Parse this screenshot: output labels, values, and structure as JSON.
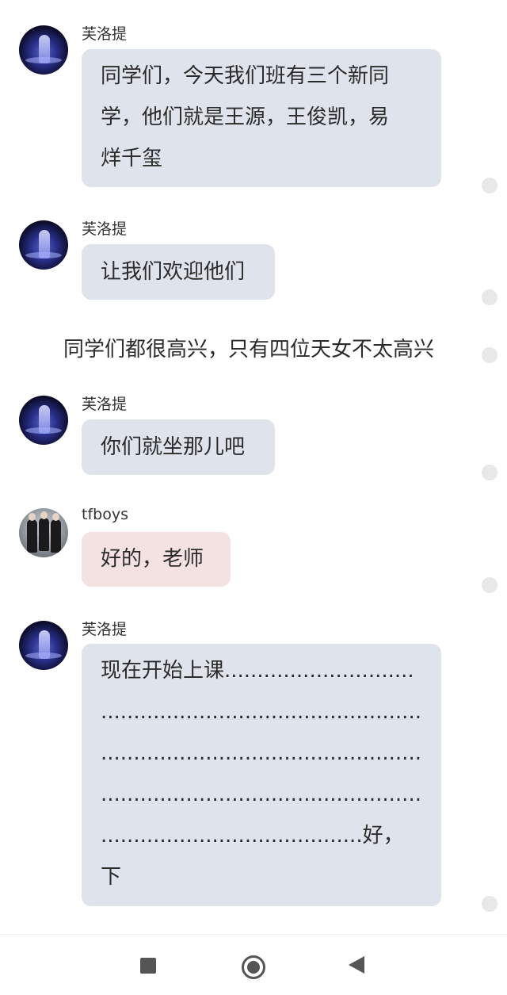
{
  "messages": [
    {
      "sender": "芙洛提",
      "text": "同学们，今天我们班有三个新同\n学，他们就是王源，王俊凯，易\n烊千玺"
    },
    {
      "sender": "芙洛提",
      "text": "让我们欢迎他们"
    },
    {
      "sender": "芙洛提",
      "text": "你们就坐那儿吧"
    },
    {
      "sender": "tfboys",
      "text": "好的，老师"
    },
    {
      "sender": "芙洛提",
      "text": "现在开始上课.............................\n.................................................\n.................................................\n.................................................\n........................................好，下\n课"
    }
  ],
  "narration": "同学们都很高兴，只有四位天女不太高兴",
  "icons": {
    "teacher_avatar": "avatar-icon",
    "tfboys_avatar": "avatar-icon",
    "recent_apps": "square-icon",
    "home": "circle-icon",
    "back": "triangle-icon"
  },
  "colors": {
    "bubble_default": "#dfe4ec",
    "bubble_pink": "#f4e1e2"
  }
}
